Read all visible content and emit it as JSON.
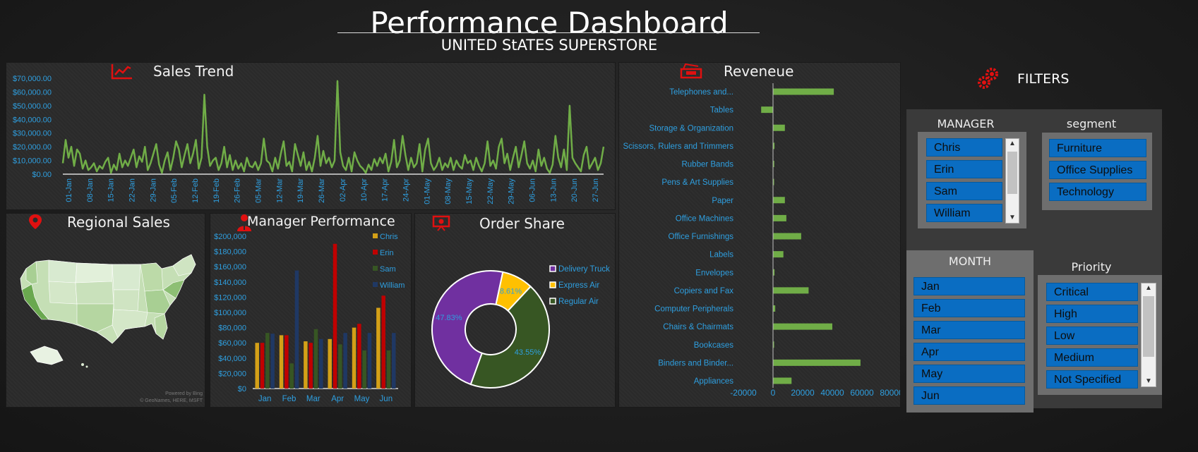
{
  "header": {
    "title": "Performance Dashboard",
    "subtitle": "UNITED StATES SUPERSTORE"
  },
  "sales_trend": {
    "title": "Sales Trend",
    "icon": "line-chart-icon",
    "chart_data": {
      "type": "line",
      "ylim": [
        0,
        70000
      ],
      "y_ticks": [
        "$0.00",
        "$10,000.00",
        "$20,000.00",
        "$30,000.00",
        "$40,000.00",
        "$50,000.00",
        "$60,000.00",
        "$70,000.00"
      ],
      "x_ticks": [
        "01-Jan",
        "08-Jan",
        "15-Jan",
        "22-Jan",
        "29-Jan",
        "05-Feb",
        "12-Feb",
        "19-Feb",
        "26-Feb",
        "05-Mar",
        "12-Mar",
        "19-Mar",
        "26-Mar",
        "02-Apr",
        "10-Apr",
        "17-Apr",
        "24-Apr",
        "01-May",
        "08-May",
        "15-May",
        "22-May",
        "29-May",
        "06-Jun",
        "13-Jun",
        "20-Jun",
        "27-Jun"
      ],
      "series": [
        {
          "color": "#70ad47",
          "values": [
            8000,
            25000,
            12000,
            20000,
            6000,
            18000,
            15000,
            4000,
            10000,
            3000,
            5000,
            8000,
            2000,
            6000,
            4000,
            9000,
            12000,
            1000,
            7000,
            3000,
            15000,
            5000,
            10000,
            6000,
            12000,
            18000,
            5000,
            13000,
            9000,
            20000,
            3000,
            8000,
            15000,
            22000,
            7000,
            1000,
            10000,
            16000,
            3000,
            12000,
            24000,
            18000,
            5000,
            14000,
            22000,
            8000,
            15000,
            25000,
            4000,
            12000,
            58000,
            20000,
            6000,
            10000,
            12000,
            3000,
            8000,
            20000,
            5000,
            14000,
            3000,
            10000,
            4000,
            8000,
            2000,
            12000,
            6000,
            5000,
            9000,
            3000,
            8000,
            26000,
            10000,
            8000,
            2000,
            12000,
            4000,
            15000,
            24000,
            6000,
            9000,
            2000,
            22000,
            14000,
            6000,
            16000,
            3000,
            9000,
            2000,
            12000,
            28000,
            6000,
            17000,
            8000,
            12000,
            5000,
            10000,
            68000,
            16000,
            6000,
            3000,
            12000,
            2000,
            16000,
            10000,
            6000,
            4000,
            1000,
            7000,
            3000,
            11000,
            6000,
            12000,
            8000,
            15000,
            2000,
            9000,
            25000,
            5000,
            10000,
            28000,
            14000,
            3000,
            12000,
            5000,
            8000,
            22000,
            2000,
            18000,
            26000,
            8000,
            3000,
            6000,
            12000,
            3000,
            8000,
            5000,
            12000,
            3000,
            10000,
            6000,
            4000,
            14000,
            8000,
            10000,
            3000,
            12000,
            6000,
            2000,
            8000,
            24000,
            6000,
            10000,
            4000,
            20000,
            26000,
            8000,
            15000,
            3000,
            12000,
            20000,
            5000,
            14000,
            24000,
            8000,
            4000,
            10000,
            2000,
            18000,
            6000,
            12000,
            4000,
            1000,
            7000,
            28000,
            12000,
            5000,
            18000,
            3000,
            50000,
            12000,
            8000,
            5000,
            2000,
            14000,
            20000,
            4000,
            8000,
            12000,
            3000,
            8000,
            20000
          ]
        }
      ]
    }
  },
  "revenue": {
    "title": "Reveneue",
    "icon": "cash-register-icon",
    "chart_data": {
      "type": "bar",
      "orientation": "horizontal",
      "xlim": [
        -20000,
        80000
      ],
      "x_ticks": [
        "-20000",
        "0",
        "20000",
        "40000",
        "60000",
        "80000"
      ],
      "categories": [
        "Telephones and...",
        "Tables",
        "Storage & Organization",
        "Scissors, Rulers and Trimmers",
        "Rubber Bands",
        "Pens & Art Supplies",
        "Paper",
        "Office Machines",
        "Office Furnishings",
        "Labels",
        "Envelopes",
        "Copiers and Fax",
        "Computer Peripherals",
        "Chairs & Chairmats",
        "Bookcases",
        "Binders and Binder...",
        "Appliances"
      ],
      "values": [
        41000,
        -8000,
        8000,
        1000,
        800,
        500,
        8000,
        9000,
        19000,
        7000,
        1000,
        24000,
        1500,
        40000,
        500,
        59000,
        12500
      ],
      "color": "#70ad47"
    }
  },
  "regional": {
    "title": "Regional Sales",
    "icon": "map-pin-icon",
    "credit1": "Powered by Bing",
    "credit2": "© GeoNames, HERE, MSFT"
  },
  "manager_perf": {
    "title": "Manager Performance",
    "icon": "manager-icon",
    "chart_data": {
      "type": "bar",
      "categories": [
        "Jan",
        "Feb",
        "Mar",
        "Apr",
        "May",
        "Jun"
      ],
      "ylim": [
        0,
        200000
      ],
      "y_ticks": [
        "$0",
        "$20,000",
        "$40,000",
        "$60,000",
        "$80,000",
        "$100,000",
        "$120,000",
        "$140,000",
        "$160,000",
        "$180,000",
        "$200,000"
      ],
      "series": [
        {
          "name": "Chris",
          "color": "#d4a017",
          "values": [
            60000,
            70000,
            62000,
            65000,
            80000,
            106000
          ]
        },
        {
          "name": "Erin",
          "color": "#c00000",
          "values": [
            60000,
            70000,
            60000,
            190000,
            85000,
            122000
          ]
        },
        {
          "name": "Sam",
          "color": "#375623",
          "values": [
            73000,
            33000,
            78000,
            58000,
            50000,
            50000
          ]
        },
        {
          "name": "William",
          "color": "#1f3864",
          "values": [
            72000,
            155000,
            65000,
            73000,
            73000,
            73000
          ]
        }
      ]
    }
  },
  "order_share": {
    "title": "Order Share",
    "icon": "presentation-icon",
    "chart_data": {
      "type": "pie",
      "categories": [
        "Delivery Truck",
        "Express Air",
        "Regular Air"
      ],
      "values": [
        47.83,
        8.61,
        43.55
      ],
      "labels": [
        "47.83%",
        "8.61%",
        "43.55%"
      ],
      "colors": [
        "#7030a0",
        "#ffc000",
        "#375623"
      ]
    }
  },
  "filters": {
    "title": "FILTERS",
    "icon": "gears-icon",
    "manager": {
      "title": "MANAGER",
      "items": [
        "Chris",
        "Erin",
        "Sam",
        "William"
      ]
    },
    "segment": {
      "title": "segment",
      "items": [
        "Furniture",
        "Office Supplies",
        "Technology"
      ]
    },
    "month": {
      "title": "MONTH",
      "items": [
        "Jan",
        "Feb",
        "Mar",
        "Apr",
        "May",
        "Jun"
      ]
    },
    "priority": {
      "title": "Priority",
      "items": [
        "Critical",
        "High",
        "Low",
        "Medium",
        "Not Specified"
      ]
    }
  }
}
